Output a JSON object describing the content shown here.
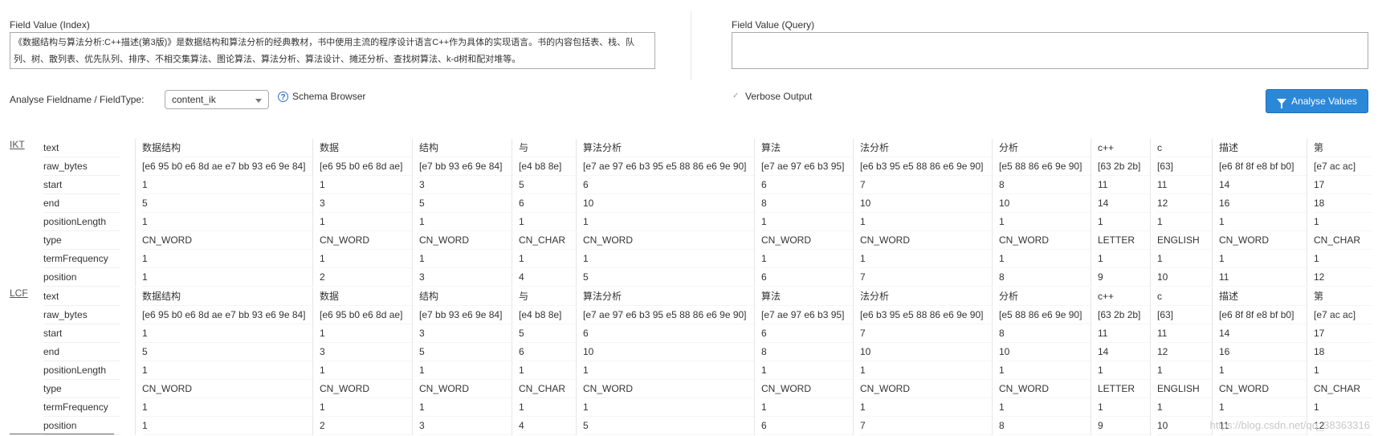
{
  "index": {
    "label": "Field Value (Index)",
    "value": "《数据结构与算法分析:C++描述(第3版)》是数据结构和算法分析的经典教材，书中使用主流的程序设计语言C++作为具体的实现语言。书的内容包括表、栈、队列、树、散列表、优先队列、排序、不相交集算法、图论算法、算法分析、算法设计、摊还分析、查找树算法、k-d树和配对堆等。"
  },
  "query": {
    "label": "Field Value (Query)",
    "value": ""
  },
  "controls": {
    "fieldtype_label": "Analyse Fieldname / FieldType:",
    "fieldtype_value": "content_ik",
    "schema_label": "Schema Browser",
    "verbose_label": "Verbose Output",
    "analyse_label": "Analyse Values"
  },
  "row_labels": [
    "text",
    "raw_bytes",
    "start",
    "end",
    "positionLength",
    "type",
    "termFrequency",
    "position"
  ],
  "analyzers": [
    {
      "name": "IKT",
      "tokens": [
        {
          "text": "数据结构",
          "raw_bytes": "[e6 95 b0 e6 8d ae e7 bb 93 e6 9e 84]",
          "start": "1",
          "end": "5",
          "positionLength": "1",
          "type": "CN_WORD",
          "termFrequency": "1",
          "position": "1"
        },
        {
          "text": "数据",
          "raw_bytes": "[e6 95 b0 e6 8d ae]",
          "start": "1",
          "end": "3",
          "positionLength": "1",
          "type": "CN_WORD",
          "termFrequency": "1",
          "position": "2"
        },
        {
          "text": "结构",
          "raw_bytes": "[e7 bb 93 e6 9e 84]",
          "start": "3",
          "end": "5",
          "positionLength": "1",
          "type": "CN_WORD",
          "termFrequency": "1",
          "position": "3"
        },
        {
          "text": "与",
          "raw_bytes": "[e4 b8 8e]",
          "start": "5",
          "end": "6",
          "positionLength": "1",
          "type": "CN_CHAR",
          "termFrequency": "1",
          "position": "4"
        },
        {
          "text": "算法分析",
          "raw_bytes": "[e7 ae 97 e6 b3 95 e5 88 86 e6 9e 90]",
          "start": "6",
          "end": "10",
          "positionLength": "1",
          "type": "CN_WORD",
          "termFrequency": "1",
          "position": "5"
        },
        {
          "text": "算法",
          "raw_bytes": "[e7 ae 97 e6 b3 95]",
          "start": "6",
          "end": "8",
          "positionLength": "1",
          "type": "CN_WORD",
          "termFrequency": "1",
          "position": "6"
        },
        {
          "text": "法分析",
          "raw_bytes": "[e6 b3 95 e5 88 86 e6 9e 90]",
          "start": "7",
          "end": "10",
          "positionLength": "1",
          "type": "CN_WORD",
          "termFrequency": "1",
          "position": "7"
        },
        {
          "text": "分析",
          "raw_bytes": "[e5 88 86 e6 9e 90]",
          "start": "8",
          "end": "10",
          "positionLength": "1",
          "type": "CN_WORD",
          "termFrequency": "1",
          "position": "8"
        },
        {
          "text": "c++",
          "raw_bytes": "[63 2b 2b]",
          "start": "11",
          "end": "14",
          "positionLength": "1",
          "type": "LETTER",
          "termFrequency": "1",
          "position": "9"
        },
        {
          "text": "c",
          "raw_bytes": "[63]",
          "start": "11",
          "end": "12",
          "positionLength": "1",
          "type": "ENGLISH",
          "termFrequency": "1",
          "position": "10"
        },
        {
          "text": "描述",
          "raw_bytes": "[e6 8f 8f e8 bf b0]",
          "start": "14",
          "end": "16",
          "positionLength": "1",
          "type": "CN_WORD",
          "termFrequency": "1",
          "position": "11"
        },
        {
          "text": "第",
          "raw_bytes": "[e7 ac ac]",
          "start": "17",
          "end": "18",
          "positionLength": "1",
          "type": "CN_CHAR",
          "termFrequency": "1",
          "position": "12"
        }
      ]
    },
    {
      "name": "LCF",
      "tokens": [
        {
          "text": "数据结构",
          "raw_bytes": "[e6 95 b0 e6 8d ae e7 bb 93 e6 9e 84]",
          "start": "1",
          "end": "5",
          "positionLength": "1",
          "type": "CN_WORD",
          "termFrequency": "1",
          "position": "1"
        },
        {
          "text": "数据",
          "raw_bytes": "[e6 95 b0 e6 8d ae]",
          "start": "1",
          "end": "3",
          "positionLength": "1",
          "type": "CN_WORD",
          "termFrequency": "1",
          "position": "2"
        },
        {
          "text": "结构",
          "raw_bytes": "[e7 bb 93 e6 9e 84]",
          "start": "3",
          "end": "5",
          "positionLength": "1",
          "type": "CN_WORD",
          "termFrequency": "1",
          "position": "3"
        },
        {
          "text": "与",
          "raw_bytes": "[e4 b8 8e]",
          "start": "5",
          "end": "6",
          "positionLength": "1",
          "type": "CN_CHAR",
          "termFrequency": "1",
          "position": "4"
        },
        {
          "text": "算法分析",
          "raw_bytes": "[e7 ae 97 e6 b3 95 e5 88 86 e6 9e 90]",
          "start": "6",
          "end": "10",
          "positionLength": "1",
          "type": "CN_WORD",
          "termFrequency": "1",
          "position": "5"
        },
        {
          "text": "算法",
          "raw_bytes": "[e7 ae 97 e6 b3 95]",
          "start": "6",
          "end": "8",
          "positionLength": "1",
          "type": "CN_WORD",
          "termFrequency": "1",
          "position": "6"
        },
        {
          "text": "法分析",
          "raw_bytes": "[e6 b3 95 e5 88 86 e6 9e 90]",
          "start": "7",
          "end": "10",
          "positionLength": "1",
          "type": "CN_WORD",
          "termFrequency": "1",
          "position": "7"
        },
        {
          "text": "分析",
          "raw_bytes": "[e5 88 86 e6 9e 90]",
          "start": "8",
          "end": "10",
          "positionLength": "1",
          "type": "CN_WORD",
          "termFrequency": "1",
          "position": "8"
        },
        {
          "text": "c++",
          "raw_bytes": "[63 2b 2b]",
          "start": "11",
          "end": "14",
          "positionLength": "1",
          "type": "LETTER",
          "termFrequency": "1",
          "position": "9"
        },
        {
          "text": "c",
          "raw_bytes": "[63]",
          "start": "11",
          "end": "12",
          "positionLength": "1",
          "type": "ENGLISH",
          "termFrequency": "1",
          "position": "10"
        },
        {
          "text": "描述",
          "raw_bytes": "[e6 8f 8f e8 bf b0]",
          "start": "14",
          "end": "16",
          "positionLength": "1",
          "type": "CN_WORD",
          "termFrequency": "1",
          "position": "11"
        },
        {
          "text": "第",
          "raw_bytes": "[e7 ac ac]",
          "start": "17",
          "end": "18",
          "positionLength": "1",
          "type": "CN_CHAR",
          "termFrequency": "1",
          "position": "12"
        }
      ]
    }
  ],
  "watermark": "https://blog.csdn.net/qq_38363316"
}
